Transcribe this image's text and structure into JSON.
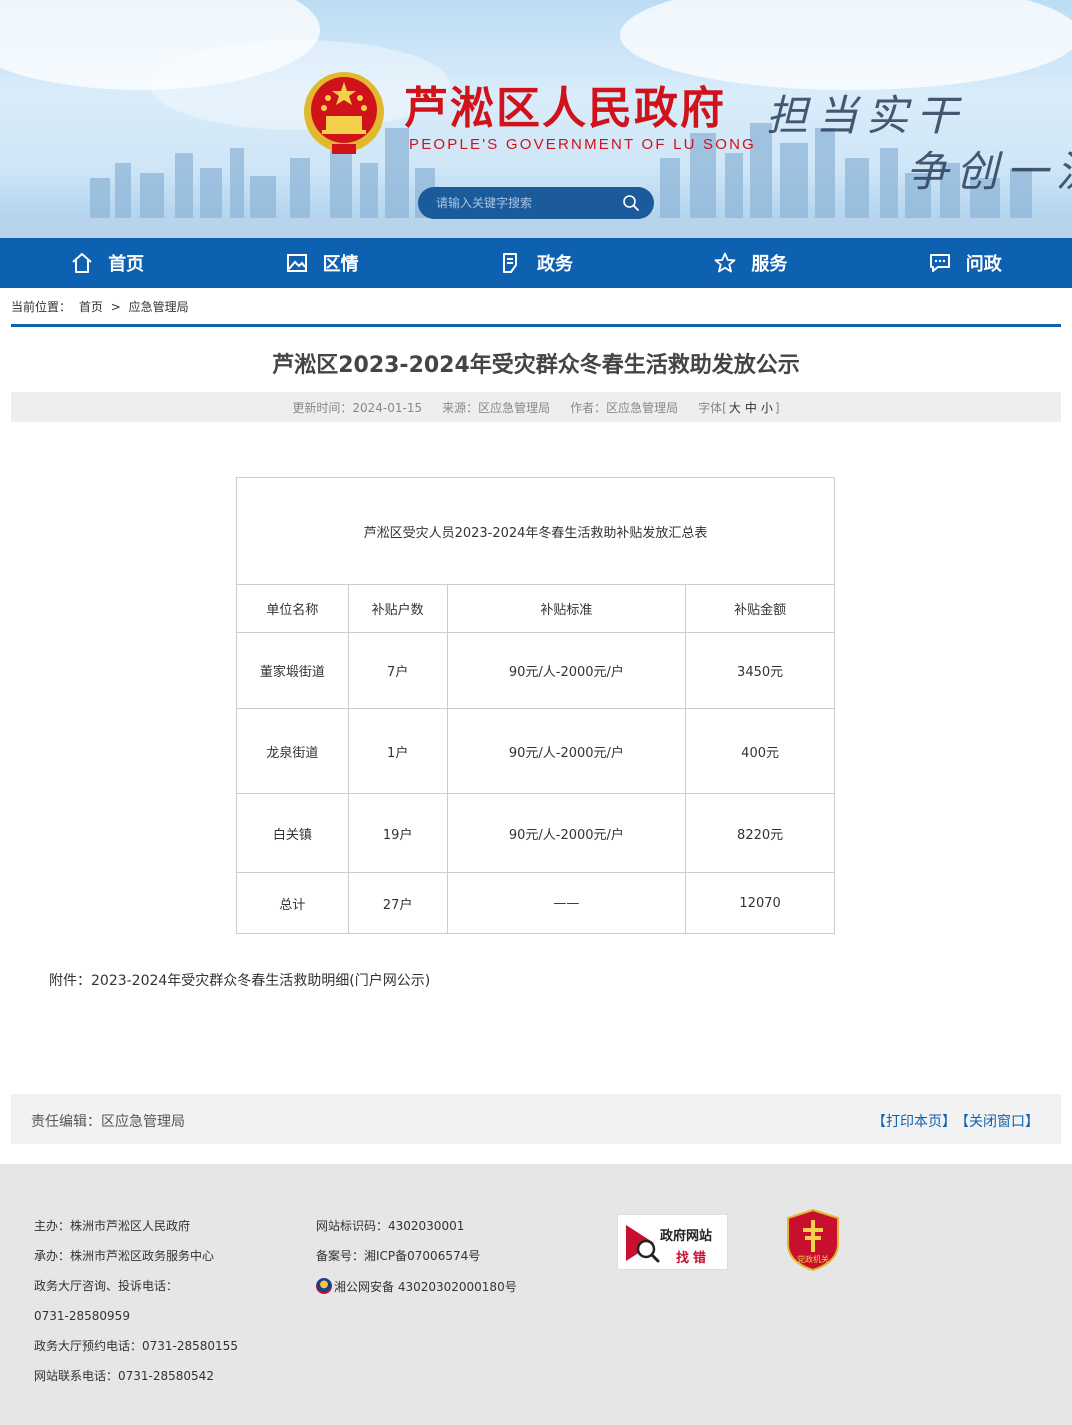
{
  "header": {
    "site_title": "芦淞区人民政府",
    "site_subtitle": "PEOPLE'S GOVERNMENT OF  LU SONG",
    "slogan_line1": "担当实干",
    "slogan_line2": "争创一流",
    "search_placeholder": "请输入关键字搜索"
  },
  "nav": [
    {
      "label": "首页",
      "icon": "home-icon"
    },
    {
      "label": "区情",
      "icon": "picture-icon"
    },
    {
      "label": "政务",
      "icon": "document-icon"
    },
    {
      "label": "服务",
      "icon": "star-icon"
    },
    {
      "label": "问政",
      "icon": "chat-icon"
    }
  ],
  "breadcrumb": {
    "prefix": "当前位置：",
    "home": "首页",
    "sep": ">",
    "current": "应急管理局"
  },
  "article": {
    "title": "芦淞区2023-2024年受灾群众冬春生活救助发放公示",
    "updated": "更新时间：2024-01-15",
    "source": "来源：区应急管理局",
    "author": "作者：区应急管理局",
    "font_label": "字体[",
    "font_large": "大",
    "font_medium": "中",
    "font_small": "小",
    "font_end": "]"
  },
  "table": {
    "caption": "芦淞区受灾人员2023-2024年冬春生活救助补贴发放汇总表",
    "headers": [
      "单位名称",
      "补贴户数",
      "补贴标准",
      "补贴金额"
    ],
    "rows": [
      [
        "董家塅街道",
        "7户",
        "90元/人-2000元/户",
        "3450元"
      ],
      [
        "龙泉街道",
        "1户",
        "90元/人-2000元/户",
        "400元"
      ],
      [
        "白关镇",
        "19户",
        "90元/人-2000元/户",
        "8220元"
      ],
      [
        "总计",
        "27户",
        "——",
        "12070"
      ]
    ]
  },
  "attachment": "附件：2023-2024年受灾群众冬春生活救助明细(门户网公示)",
  "editor": {
    "label": "责任编辑：区应急管理局",
    "print": "【打印本页】",
    "close": "【关闭窗口】"
  },
  "footer": {
    "col1": [
      "主办：株洲市芦淞区人民政府",
      "承办：株洲市芦淞区政务服务中心",
      "政务大厅咨询、投诉电话：",
      "0731-28580959",
      "政务大厅预约电话：0731-28580155",
      "网站联系电话：0731-28580542"
    ],
    "col2": [
      "网站标识码：4302030001",
      "备案号：湘ICP备07006574号",
      "湘公网安备 43020302000180号"
    ],
    "badge_line1": "政府网站",
    "badge_line2": "找错",
    "party_badge": "党政机关"
  },
  "colors": {
    "primary": "#0e60b0",
    "title_red": "#d0121b"
  }
}
